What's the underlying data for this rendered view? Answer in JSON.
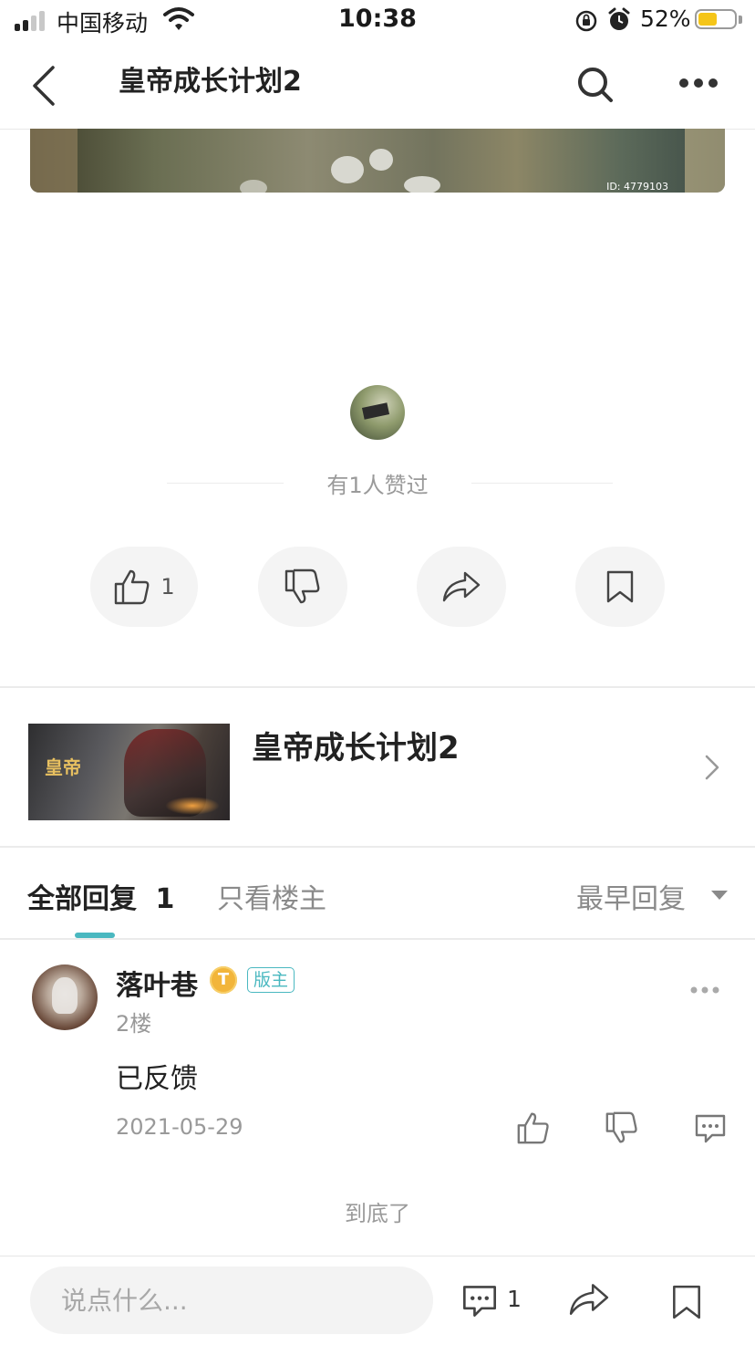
{
  "status_bar": {
    "carrier": "中国移动",
    "time": "10:38",
    "battery_percent": "52%",
    "battery_level": 0.52,
    "icons": [
      "signal-icon",
      "wifi-icon",
      "rotation-lock-icon",
      "alarm-icon",
      "battery-icon"
    ]
  },
  "nav": {
    "title": "皇帝成长计划2",
    "icons": [
      "back-arrow-icon",
      "search-icon",
      "more-horizontal-icon"
    ]
  },
  "post_image": {
    "id_label": "ID: 4779103"
  },
  "likes": {
    "summary": "有1人赞过"
  },
  "actions": {
    "like_count": "1",
    "icons": [
      "thumbs-up-icon",
      "thumbs-down-icon",
      "share-icon",
      "bookmark-icon"
    ]
  },
  "game_card": {
    "title": "皇帝成长计划2",
    "cover_logo": "皇帝",
    "icons": [
      "chevron-right-icon"
    ]
  },
  "reply_tabs": {
    "all_label": "全部回复",
    "all_count": "1",
    "op_only_label": "只看楼主",
    "sort_label": "最早回复"
  },
  "reply": {
    "author": "落叶巷",
    "level_badge": "T",
    "role_badge": "版主",
    "floor": "2楼",
    "content": "已反馈",
    "date": "2021-05-29"
  },
  "end_text": "到底了",
  "bottom_bar": {
    "input_placeholder": "说点什么...",
    "comment_count": "1"
  },
  "colors": {
    "accent": "#4ab8c0",
    "badge_gold": "#f2b53a",
    "battery": "#f5c518",
    "muted_text": "#999999"
  }
}
